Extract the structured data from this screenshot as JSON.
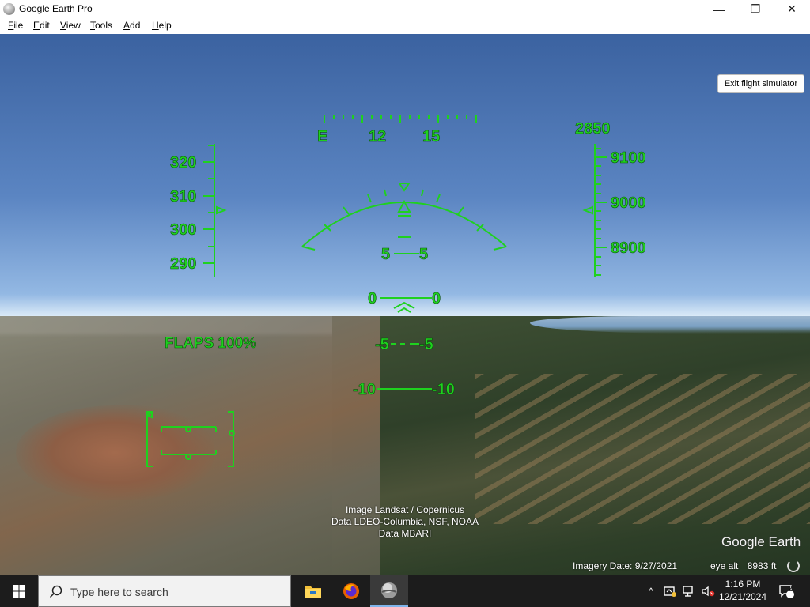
{
  "window": {
    "title": "Google Earth Pro",
    "controls": {
      "minimize": "—",
      "maximize": "❐",
      "close": "✕"
    }
  },
  "menu": [
    {
      "key": "F",
      "rest": "ile"
    },
    {
      "key": "E",
      "rest": "dit"
    },
    {
      "key": "V",
      "rest": "iew"
    },
    {
      "key": "T",
      "rest": "ools"
    },
    {
      "key": "A",
      "rest": "dd"
    },
    {
      "key": "H",
      "rest": "elp"
    }
  ],
  "flight_sim": {
    "exit_button": "Exit flight simulator",
    "hud": {
      "heading_labels": [
        "E",
        "12",
        "15"
      ],
      "speed_labels": [
        "320",
        "310",
        "300",
        "290"
      ],
      "vertical_speed": "2850",
      "altitude_labels": [
        "9100",
        "9000",
        "8900"
      ],
      "pitch": {
        "up5": "5",
        "zero": "0",
        "down5": "-5",
        "down10": "-10"
      },
      "flaps": "FLAPS 100%",
      "hud_color": "#1fd11f"
    }
  },
  "imagery": {
    "credits": [
      "Image Landsat / Copernicus",
      "Data LDEO-Columbia, NSF, NOAA",
      "Data MBARI"
    ],
    "brand": "Google Earth",
    "imagery_date": "Imagery Date: 9/27/2021",
    "eye_alt_label": "eye alt",
    "eye_alt_value": "8983 ft"
  },
  "taskbar": {
    "search_placeholder": "Type here to search",
    "apps": [
      "file-explorer",
      "firefox",
      "google-earth-pro"
    ],
    "time": "1:16 PM",
    "date": "12/21/2024",
    "notification_count": "2"
  }
}
